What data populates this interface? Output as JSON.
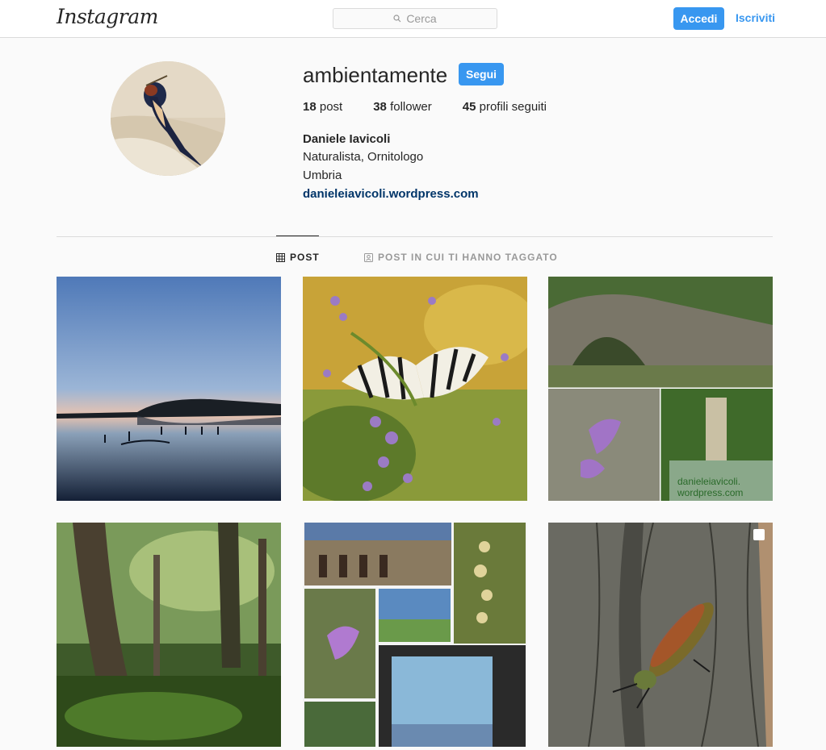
{
  "nav": {
    "logo": "Instagram",
    "search_placeholder": "Cerca",
    "login_label": "Accedi",
    "signup_label": "Iscriviti"
  },
  "profile": {
    "username": "ambientamente",
    "follow_label": "Segui",
    "posts_count": "18",
    "posts_label": "post",
    "followers_count": "38",
    "followers_label": "follower",
    "following_count": "45",
    "following_label": "profili seguiti",
    "full_name": "Daniele Iavicoli",
    "bio_line1": "Naturalista, Ornitologo",
    "bio_line2": "Umbria",
    "website": "danieleiavicoli.wordpress.com"
  },
  "tabs": [
    {
      "label": "POST",
      "active": true
    },
    {
      "label": "POST IN CUI TI HANNO TAGGATO",
      "active": false
    }
  ],
  "grid": {
    "watermark_line1": "danieleiavicoli.",
    "watermark_line2": "wordpress.com"
  },
  "colors": {
    "accent": "#3897f0",
    "link": "#003569",
    "border": "#dbdbdb",
    "background": "#fafafa"
  }
}
